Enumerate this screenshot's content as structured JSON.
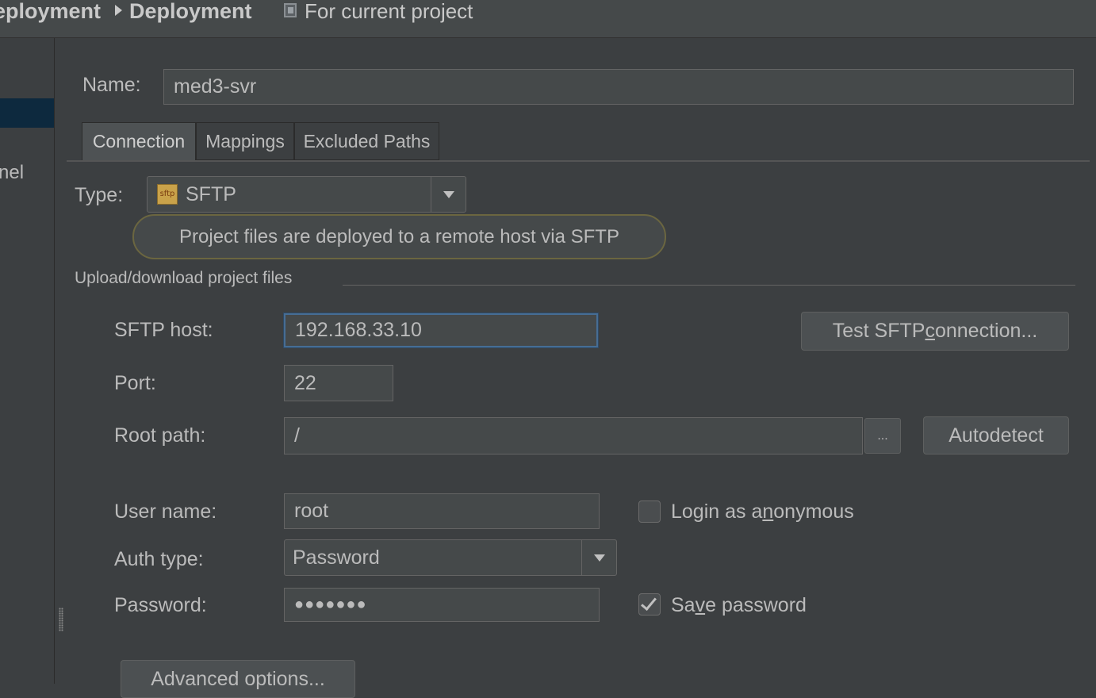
{
  "header": {
    "crumb_parent": "eployment",
    "crumb_current": "Deployment",
    "scope_label": "For current project"
  },
  "sidebar": {
    "partial_item": "nel"
  },
  "name": {
    "label": "Name:",
    "value": "med3-svr"
  },
  "tabs": [
    {
      "label": "Connection",
      "active": true
    },
    {
      "label": "Mappings",
      "active": false
    },
    {
      "label": "Excluded Paths",
      "active": false
    }
  ],
  "type": {
    "label": "Type:",
    "icon_text": "sftp",
    "value": "SFTP",
    "hint": "Project files are deployed to a remote host via SFTP"
  },
  "upload_section": {
    "title": "Upload/download project files"
  },
  "sftp_host": {
    "label": "SFTP host:",
    "value": "192.168.33.10"
  },
  "test_button": {
    "pre": "Test SFTP ",
    "mnemonic": "c",
    "post": "onnection..."
  },
  "port": {
    "label": "Port:",
    "value": "22"
  },
  "root_path": {
    "label": "Root path:",
    "value": "/",
    "browse_label": "...",
    "autodetect_label": "Autodetect"
  },
  "user_name": {
    "label": "User name:",
    "value": "root"
  },
  "login_anonymous": {
    "pre": "Login as a",
    "mnemonic": "n",
    "post": "onymous",
    "checked": false
  },
  "auth_type": {
    "label": "Auth type:",
    "value": "Password"
  },
  "password": {
    "label": "Password:",
    "value": "●●●●●●●"
  },
  "save_password": {
    "pre": "Sa",
    "mnemonic": "v",
    "post": "e password",
    "checked": true
  },
  "advanced_button": {
    "label": "Advanced options..."
  }
}
